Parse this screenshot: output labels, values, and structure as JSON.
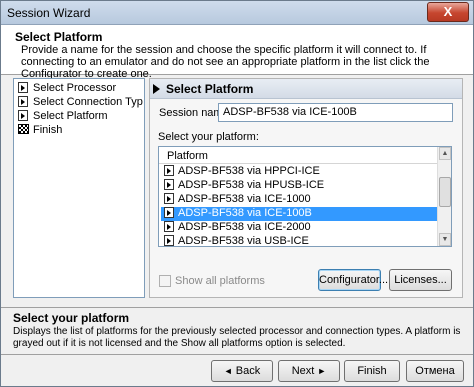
{
  "window": {
    "title": "Session Wizard",
    "close_symbol": "X"
  },
  "header": {
    "title": "Select Platform",
    "description": "Provide a name for the session and choose the specific platform it will connect to. If connecting to an emulator and do not see an appropriate platform in the list click the Configurator to create one."
  },
  "nav": {
    "items": [
      {
        "label": "Select Processor",
        "icon": "arrow-page-icon"
      },
      {
        "label": "Select Connection Typ",
        "icon": "arrow-page-icon"
      },
      {
        "label": "Select Platform",
        "icon": "arrow-page-icon"
      },
      {
        "label": "Finish",
        "icon": "checkered-flag-icon"
      }
    ]
  },
  "panel": {
    "title": "Select Platform",
    "session_name_label": "Session name:",
    "session_name_value": "ADSP-BF538 via ICE-100B",
    "select_platform_label": "Select your platform:",
    "list_header": "Platform",
    "platforms": [
      "ADSP-BF538 via HPPCI-ICE",
      "ADSP-BF538 via HPUSB-ICE",
      "ADSP-BF538 via ICE-1000",
      "ADSP-BF538 via ICE-100B",
      "ADSP-BF538 via ICE-2000",
      "ADSP-BF538 via USB-ICE"
    ],
    "selected_platform": "ADSP-BF538 via ICE-100B",
    "show_all_label": "Show all platforms",
    "show_all_checked": false,
    "configurator_label": "Configurator...",
    "licenses_label": "Licenses..."
  },
  "help": {
    "title": "Select your platform",
    "description": "Displays the list of platforms for the previously selected processor and connection types. A platform is grayed out if it is not licensed and the Show all platforms option is selected."
  },
  "footer": {
    "back_label": "Back",
    "next_label": "Next",
    "finish_label": "Finish",
    "cancel_label": "Отмена",
    "back_arrow": "◄",
    "next_arrow": "►"
  },
  "colors": {
    "selection": "#3399ff",
    "close_button": "#c6462f"
  }
}
